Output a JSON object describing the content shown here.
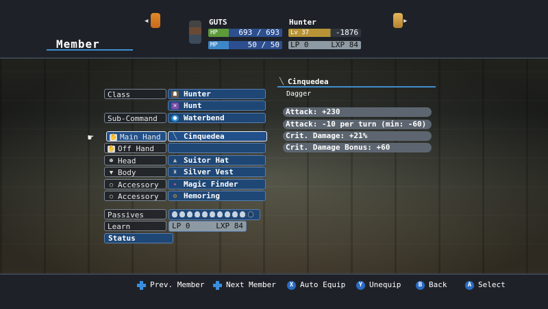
{
  "header": {
    "title": "Member",
    "character": {
      "name": "GUTS",
      "job": "Hunter",
      "hp": {
        "label": "HP",
        "current": "693",
        "max": "693"
      },
      "mp": {
        "label": "MP",
        "current": "50",
        "max": "50"
      },
      "lv": {
        "label": "Lv",
        "value": "37",
        "extra": "-1876"
      },
      "lp": {
        "label": "LP",
        "value": "0",
        "lxp_label": "LXP",
        "lxp": "84"
      }
    }
  },
  "equipment": {
    "class_label": "Class",
    "class_value": "Hunter",
    "command_value": "Hunt",
    "subcommand_label": "Sub-Command",
    "subcommand_value": "Waterbend",
    "main_hand_label": "Main Hand",
    "main_hand_value": "Cinquedea",
    "off_hand_label": "Off Hand",
    "off_hand_value": "",
    "head_label": "Head",
    "head_value": "Suitor Hat",
    "body_label": "Body",
    "body_value": "Silver Vest",
    "accessory1_label": "Accessory",
    "accessory1_value": "Magic Finder",
    "accessory2_label": "Accessory",
    "accessory2_value": "Hemoring",
    "passives_label": "Passives",
    "passives_filled": 10,
    "passives_total": 11,
    "learn_label": "Learn",
    "learn_lp_label": "LP",
    "learn_lp": "0",
    "learn_lxp_label": "LXP",
    "learn_lxp": "84",
    "status_label": "Status"
  },
  "detail": {
    "title": "Cinquedea",
    "type": "Dagger",
    "stats": [
      "Attack:  +230",
      "Attack:  -10 per turn  (min: -60)",
      "Crit. Damage:  +21%",
      "Crit. Damage Bonus:  +60"
    ]
  },
  "hints": {
    "prev": "Prev. Member",
    "next": "Next Member",
    "auto": "Auto Equip",
    "unequip": "Unequip",
    "back": "Back",
    "select": "Select",
    "btn_x": "X",
    "btn_y": "Y",
    "btn_b": "B",
    "btn_a": "A"
  },
  "colors": {
    "accent": "#3f8fd0",
    "panel": "#1f4775"
  }
}
